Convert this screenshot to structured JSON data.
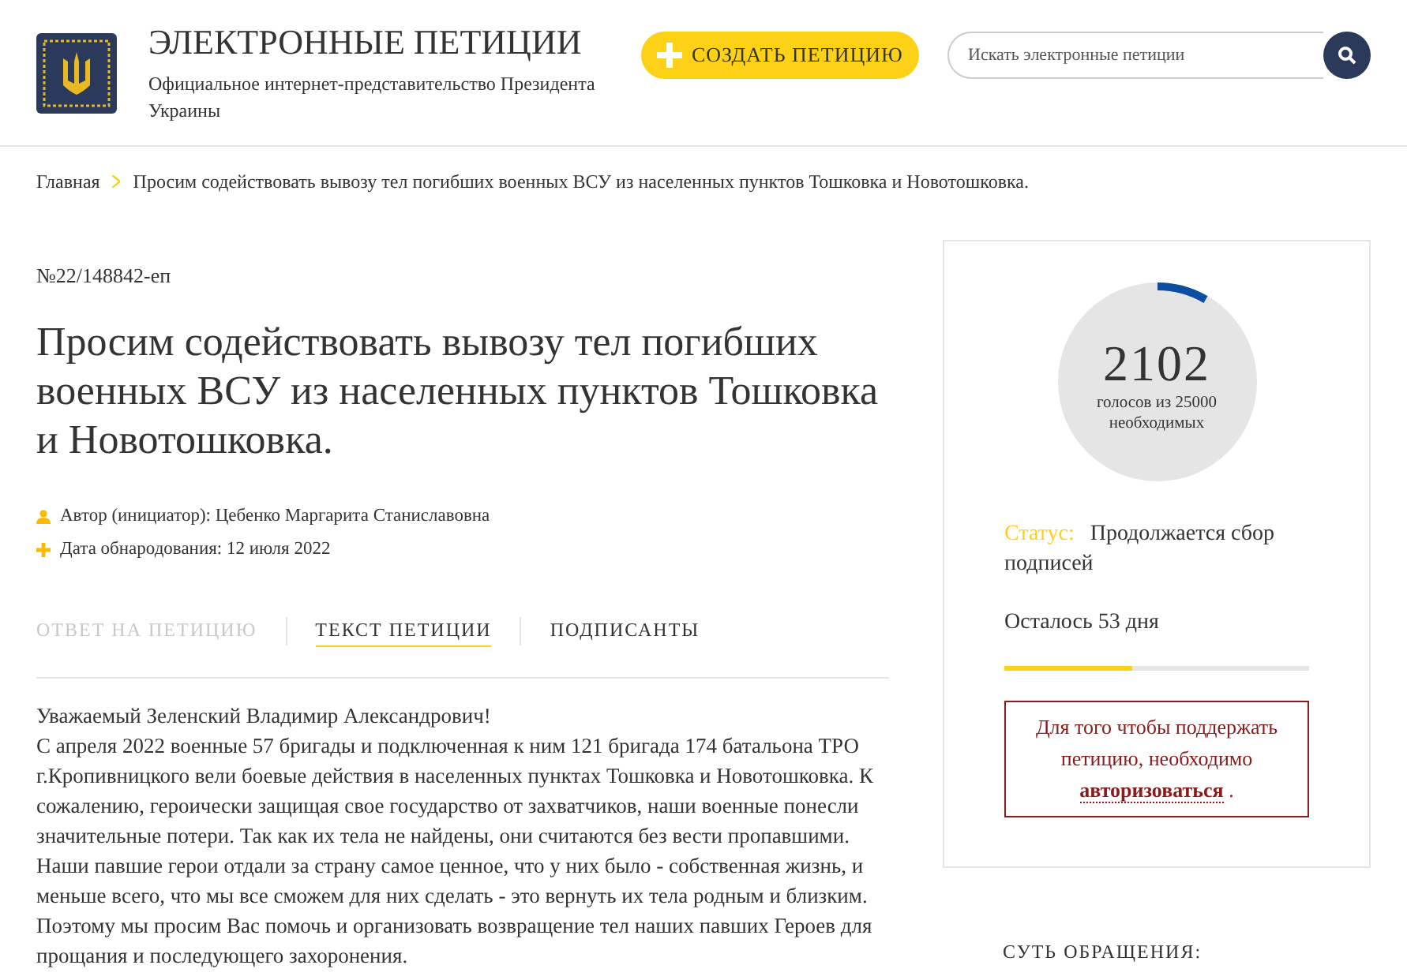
{
  "header": {
    "title": "ЭЛЕКТРОННЫЕ ПЕТИЦИИ",
    "subtitle": "Официальное интернет-представительство Президента Украины",
    "create_button": "СОЗДАТЬ ПЕТИЦИЮ",
    "search": {
      "placeholder": "Искать электронные петиции"
    }
  },
  "breadcrumb": [
    {
      "label": "Главная"
    },
    {
      "label": "Просим содействовать вывозу тел погибших военных ВСУ из населенных пунктов Тошковка и Новотошковка."
    }
  ],
  "petition": {
    "number": "№22/148842-еп",
    "title": "Просим содействовать вывозу тел погибших военных ВСУ из населенных пунктов Тошковка и Новотошковка.",
    "meta": [
      {
        "kind": "author",
        "text": "Автор (инициатор): Цебенко Маргарита Станиславовна"
      },
      {
        "kind": "date",
        "text": "Дата обнародования: 12 июля 2022"
      }
    ],
    "tabs": [
      {
        "label": "ОТВЕТ НА ПЕТИЦИЮ",
        "selected": false,
        "disabled": true
      },
      {
        "label": "ТЕКСТ ПЕТИЦИИ",
        "selected": true,
        "disabled": false
      },
      {
        "label": "ПОДПИСАНТЫ",
        "selected": false,
        "disabled": false
      }
    ],
    "greeting": "Уважаемый Зеленский Владимир Александрович!",
    "body": "С апреля 2022 военные 57 бригады и подключенная к ним 121 бригада 174 батальона ТРО г.Кропивницкого вели боевые действия в населенных пунктах Тошковка и Новотошковка. К сожалению, героически защищая свое государство от захватчиков, наши военные понесли значительные потери. Так как их тела не найдены, они считаются без вести пропавшими. Наши павшие герои отдали за страну самое ценное, что у них было - собственная жизнь, и меньше всего, что мы все сможем для них сделать - это вернуть их тела родным и близким. Поэтому мы просим Вас помочь и организовать возвращение тел наших павших Героев для прощания и последующего захоронения."
  },
  "sidebar": {
    "votes": {
      "count": "2102",
      "caption": "голосов из 25000 необходимых"
    },
    "status_label": "Статус:",
    "status": "Продолжается сбор подписей",
    "days_left": "Осталось 53 дня",
    "days_progress": {
      "level": 0.42
    },
    "auth_notice": {
      "text": "Для того чтобы поддержать петицию, необходимо",
      "link": "авторизоваться",
      "end": "."
    },
    "section_title": "СУТЬ ОБРАЩЕНИЯ:"
  }
}
